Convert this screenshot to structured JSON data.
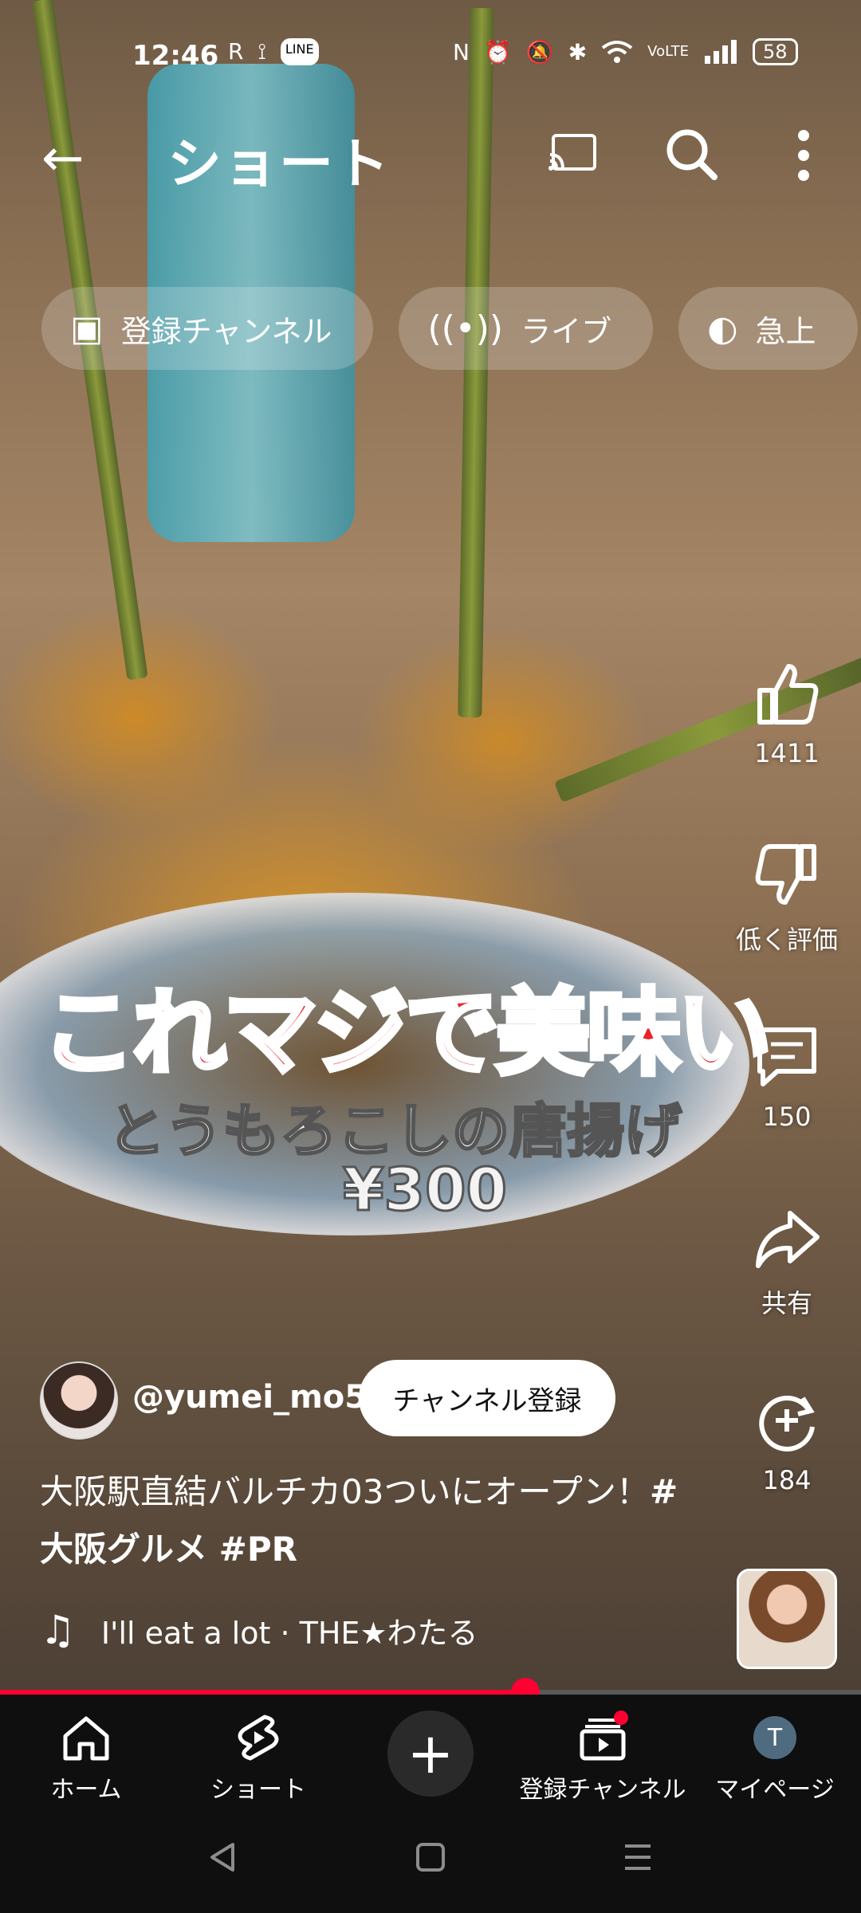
{
  "status_bar": {
    "time": "12:46",
    "left_icons": [
      "R",
      "⟟",
      "LINE"
    ],
    "right_icons": [
      "N",
      "⏰",
      "🔕",
      "✱",
      "wifi",
      "VoLTE",
      "signal"
    ],
    "battery": "58"
  },
  "top_bar": {
    "title": "ショート",
    "icons": [
      "back-arrow-icon",
      "cast-icon",
      "search-icon",
      "more-vertical-icon"
    ]
  },
  "chips": [
    {
      "label": "登録チャンネル",
      "icon": "subscriptions-icon"
    },
    {
      "label": "ライブ",
      "icon": "live-icon"
    },
    {
      "label": "急上",
      "icon": "trending-icon"
    }
  ],
  "overlay": {
    "line1": "これマジで美味い",
    "line2": "とうもろこしの唐揚げ",
    "line3": "¥300"
  },
  "actions": {
    "like": "1411",
    "dislike": "低く評価",
    "comments": "150",
    "share": "共有",
    "remix": "184"
  },
  "channel": {
    "handle": "@yumei_mo5",
    "subscribe_label": "チャンネル登録"
  },
  "description": {
    "text": "大阪駅直結バルチカ03ついにオープン！",
    "tags": "#大阪グルメ #PR"
  },
  "music": {
    "text": "I'll eat a lot · THE★わたる"
  },
  "progress": {
    "fraction": 0.61
  },
  "bottom_nav": {
    "home": "ホーム",
    "shorts": "ショート",
    "subscriptions": "登録チャンネル",
    "my_page": "マイページ",
    "avatar_letter": "T"
  },
  "colors": {
    "accent": "#ff0033",
    "nav_bg": "#0f0f0f",
    "caption_red": "#e8232b"
  }
}
